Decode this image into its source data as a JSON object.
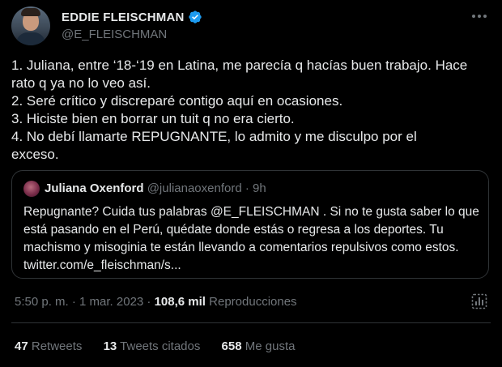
{
  "author": {
    "display_name": "EDDIE FLEISCHMAN",
    "handle": "@E_FLEISCHMAN"
  },
  "tweet": {
    "lines": [
      "1. Juliana, entre ‘18-‘19 en Latina, me parecía q hacías buen trabajo. Hace",
      "rato q ya no lo veo así.",
      "2. Seré crítico y discreparé contigo aquí en ocasiones.",
      "3. Hiciste bien en borrar un tuit q no era cierto.",
      "4. No debí llamarte REPUGNANTE, lo admito y me disculpo por el",
      "exceso."
    ]
  },
  "quoted": {
    "name": "Juliana Oxenford",
    "meta": "@julianaoxenford · 9h",
    "lines": [
      "Repugnante? Cuida tus palabras @E_FLEISCHMAN . Si no te gusta saber lo que",
      "está pasando en el Perú, quédate donde estás o regresa a los deportes. Tu",
      "machismo y misoginia te están llevando a comentarios repulsivos como estos.",
      "twitter.com/e_fleischman/s..."
    ]
  },
  "meta": {
    "datetime": "5:50 p. m. · 1 mar. 2023 · ",
    "views_count": "108,6 mil",
    "views_label": " Reproducciones"
  },
  "stats": {
    "retweets_count": "47",
    "retweets_label": "Retweets",
    "quotes_count": "13",
    "quotes_label": "Tweets citados",
    "likes_count": "658",
    "likes_label": "Me gusta"
  },
  "colors": {
    "background": "#000000",
    "text_primary": "#e7e9ea",
    "text_secondary": "#71767b",
    "border": "#2f3336",
    "verified_badge": "#1d9bf0"
  },
  "icons": {
    "verified": "verified-badge-icon",
    "more": "more-options-icon",
    "analytics": "analytics-icon"
  }
}
